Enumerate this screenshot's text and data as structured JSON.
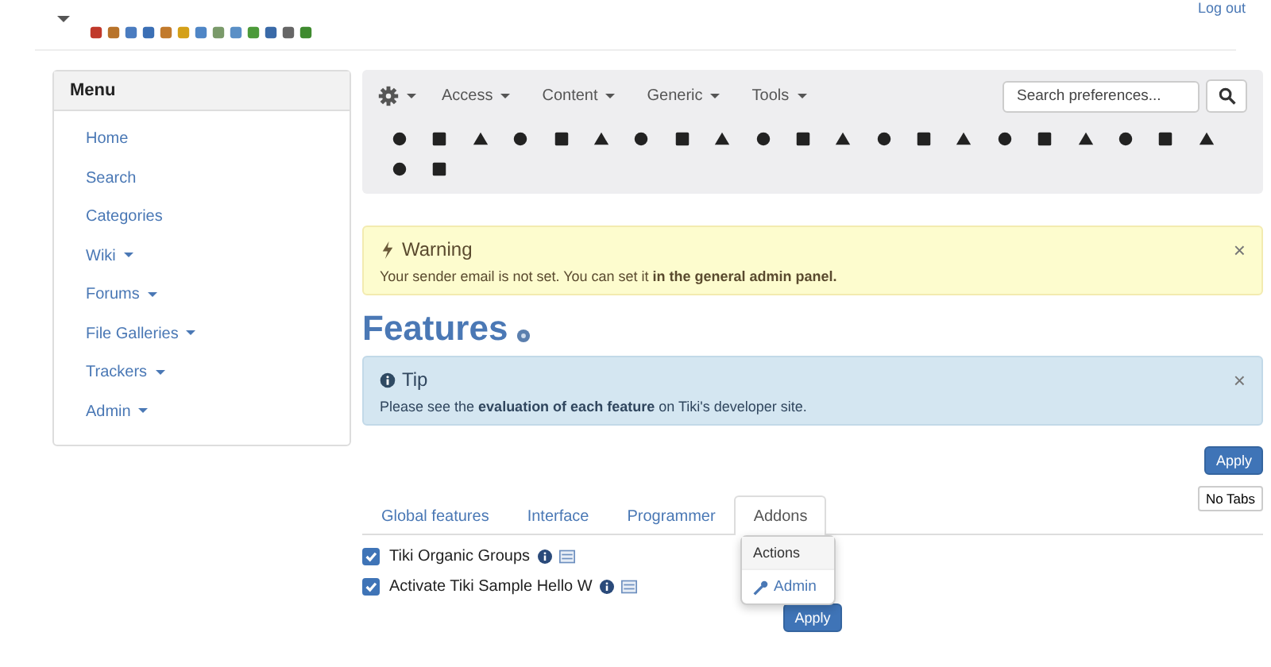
{
  "top_bar": {
    "logout": "Log out"
  },
  "menu": {
    "title": "Menu",
    "items": [
      {
        "label": "Home",
        "has_submenu": false
      },
      {
        "label": "Search",
        "has_submenu": false
      },
      {
        "label": "Categories",
        "has_submenu": false
      },
      {
        "label": "Wiki",
        "has_submenu": true
      },
      {
        "label": "Forums",
        "has_submenu": true
      },
      {
        "label": "File Galleries",
        "has_submenu": true
      },
      {
        "label": "Trackers",
        "has_submenu": true
      },
      {
        "label": "Admin",
        "has_submenu": true
      }
    ]
  },
  "admin_toolbar": {
    "dropdowns": [
      "Access",
      "Content",
      "Generic",
      "Tools"
    ],
    "search": {
      "placeholder": "Search preferences..."
    }
  },
  "warning": {
    "title": "Warning",
    "text": "Your sender email is not set. You can set it **in the general admin panel.**",
    "close": "×"
  },
  "page_title": "Features",
  "tip": {
    "title": "Tip",
    "text": "Please see the **evaluation of each feature** on Tiki's developer site.",
    "close": "×"
  },
  "apply_top": "Apply",
  "tabs": [
    {
      "label": "Global features",
      "selected": false
    },
    {
      "label": "Interface",
      "selected": false
    },
    {
      "label": "Programmer",
      "selected": false
    },
    {
      "label": "Addons",
      "selected": true
    }
  ],
  "no_tabs": "No Tabs",
  "features": [
    {
      "label": "Tiki Organic Groups",
      "checked": true
    },
    {
      "label": "Activate Tiki Sample Hello W",
      "checked": true
    }
  ],
  "popover": {
    "title": "Actions",
    "item": "Admin"
  },
  "apply_bottom": "Apply"
}
